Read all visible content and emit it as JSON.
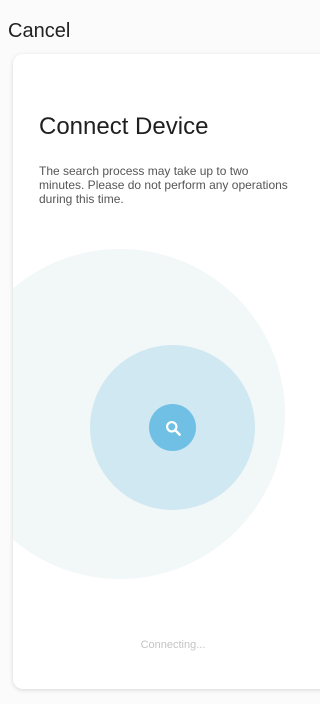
{
  "header": {
    "cancel_label": "Cancel"
  },
  "card": {
    "title": "Connect Device",
    "description": "The search process may take up to two minutes. Please do not perform any operations during this time.",
    "status_text": "Connecting..."
  },
  "icons": {
    "search_icon": "search-icon"
  },
  "colors": {
    "outer_circle": "#f2f7f8",
    "inner_circle": "#cfe8f1",
    "search_button": "#6fc0e4"
  }
}
